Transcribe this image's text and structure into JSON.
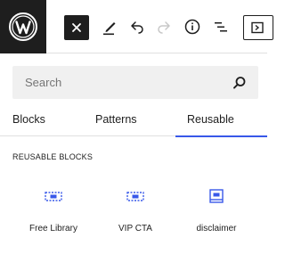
{
  "toolbar": {
    "logo_icon": "wordpress-logo-icon",
    "close_icon": "close-icon",
    "edit_icon": "pencil-icon",
    "undo_icon": "undo-icon",
    "redo_icon": "redo-icon",
    "info_icon": "info-icon",
    "list_view_icon": "list-view-icon",
    "view_icon": "view-icon"
  },
  "search": {
    "placeholder": "Search",
    "icon": "search-icon"
  },
  "tabs": [
    {
      "label": "Blocks",
      "active": false
    },
    {
      "label": "Patterns",
      "active": false
    },
    {
      "label": "Reusable",
      "active": true
    }
  ],
  "section": {
    "title": "REUSABLE BLOCKS"
  },
  "reusable_blocks": [
    {
      "label": "Free Library",
      "icon": "reusable-block-icon"
    },
    {
      "label": "VIP CTA",
      "icon": "reusable-block-icon"
    },
    {
      "label": "disclaimer",
      "icon": "reusable-block-alt-icon"
    }
  ],
  "colors": {
    "accent": "#3858e9",
    "dark": "#1e1e1e",
    "search_bg": "#f0f0f0",
    "block_icon": "#3858e9"
  }
}
